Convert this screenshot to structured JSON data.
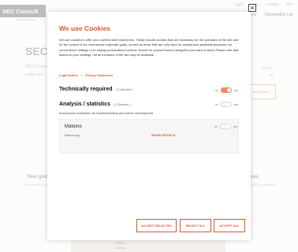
{
  "background": {
    "logo": "SEC Consult",
    "logo_sub": "An Eviden business",
    "top_nav": [
      "Login",
      "Jobs",
      "Contact",
      "EN"
    ],
    "sec_nav": [
      "Services",
      "Vulnerability Lab"
    ],
    "heading": "SEC",
    "text1": "SEC Consu",
    "text2": "mates an",
    "right_text1": "n it for",
    "right_text2": "at",
    "button": "Read more",
    "left_title": "Your glob",
    "left_text": "SEC Consult is your",
    "right_title": "ices",
    "right_text": "SEC Consult offer",
    "bottom_line1": "Rosen...",
    "bottom_line2": "Vienna..."
  },
  "close_button": "×",
  "modal": {
    "title": "We use Cookies",
    "description": "We use cookies to offer you a perfect web experience. These include cookies that are necessary for the operation of the site and for the control of our commercial corporate goals, as well as those that are only used for anonymous statistical purposes, for convenience settings or to display personalized content. Decide for yourself which categories you want to allow. Please note that based on your settings, not all functions of the site may be available.",
    "links": [
      "Legal Notice",
      "Privacy Statement"
    ],
    "link_separator": "•",
    "categories": [
      {
        "title": "Technically required",
        "count": "( 3 Service )",
        "toggle_no": "no",
        "toggle_yes": "yes",
        "enabled": true
      },
      {
        "title": "Analysis / statistics",
        "count": "( 1 Service )",
        "toggle_no": "no",
        "toggle_yes": "yes",
        "enabled": false,
        "description": "Anonymous evaluation for troubleshooting and further development"
      }
    ],
    "service": {
      "name": "Matomo",
      "subtitle": "Matomo.org",
      "toggle_no": "no",
      "toggle_yes": "yes",
      "enabled": false,
      "details": "SHOW DETAILS"
    },
    "buttons": {
      "accept_selected": "ACCEPT SELECTED",
      "reject_all": "REJECT ALL",
      "accept_all": "ACCEPT ALL"
    }
  },
  "colors": {
    "accent": "#e05529",
    "toggle_on": "#f08a63"
  }
}
